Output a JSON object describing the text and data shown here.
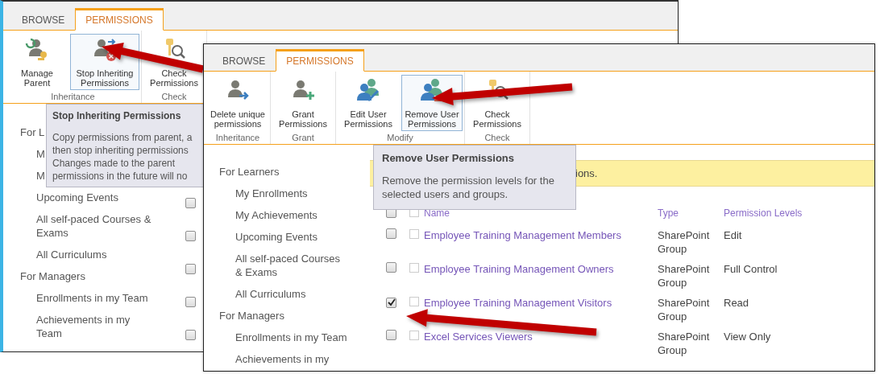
{
  "back_window": {
    "tabs": [
      {
        "label": "BROWSE",
        "selected": false
      },
      {
        "label": "PERMISSIONS",
        "selected": true
      }
    ],
    "ribbon_groups": [
      {
        "label": "Inheritance",
        "buttons": [
          {
            "label": "Manage Parent",
            "kind": "manage",
            "highlighted": false
          },
          {
            "label": "Stop Inheriting Permissions",
            "kind": "stop",
            "highlighted": true
          }
        ]
      },
      {
        "label": "Check",
        "buttons": [
          {
            "label": "Check Permissions",
            "kind": "check",
            "highlighted": false
          }
        ]
      }
    ],
    "tooltip": {
      "title": "Stop Inheriting Permissions",
      "body": "Copy permissions from parent, a\nthen stop inheriting permissions\nChanges made to the parent\npermissions in the future will no"
    },
    "sidebar": [
      {
        "label": "For L",
        "children": [
          {
            "label": "M"
          },
          {
            "label": "M"
          },
          {
            "label": "Upcoming Events"
          },
          {
            "label": "All self-paced Courses & Exams"
          },
          {
            "label": "All Curriculums"
          }
        ]
      },
      {
        "label": "For Managers",
        "children": [
          {
            "label": "Enrollments in my Team"
          },
          {
            "label": "Achievements in my Team"
          }
        ]
      }
    ],
    "row_checkboxes": [
      {
        "checked": false
      },
      {
        "checked": false
      },
      {
        "checked": false
      },
      {
        "checked": false
      },
      {
        "checked": false
      }
    ]
  },
  "front_window": {
    "tabs": [
      {
        "label": "BROWSE",
        "selected": false
      },
      {
        "label": "PERMISSIONS",
        "selected": true
      }
    ],
    "ribbon_groups": [
      {
        "label": "Inheritance",
        "buttons": [
          {
            "label": "Delete unique permissions",
            "kind": "delete",
            "highlighted": false
          }
        ]
      },
      {
        "label": "Grant",
        "buttons": [
          {
            "label": "Grant Permissions",
            "kind": "grant",
            "highlighted": false
          }
        ]
      },
      {
        "label": "Modify",
        "buttons": [
          {
            "label": "Edit User Permissions",
            "kind": "edit",
            "highlighted": false
          },
          {
            "label": "Remove User Permissions",
            "kind": "remove",
            "highlighted": true
          }
        ]
      },
      {
        "label": "Check",
        "buttons": [
          {
            "label": "Check Permissions",
            "kind": "check",
            "highlighted": false
          }
        ]
      }
    ],
    "tooltip": {
      "title": "Remove User Permissions",
      "body": "Remove the permission levels for the\nselected users and groups."
    },
    "banner": "ions.",
    "sidebar": [
      {
        "label": "For Learners",
        "children": [
          {
            "label": "My Enrollments"
          },
          {
            "label": "My Achievements"
          },
          {
            "label": "Upcoming Events"
          },
          {
            "label": "All self-paced Courses & Exams"
          },
          {
            "label": "All Curriculums"
          }
        ]
      },
      {
        "label": "For Managers",
        "children": [
          {
            "label": "Enrollments in my Team"
          },
          {
            "label": "Achievements in my"
          }
        ]
      }
    ],
    "table": {
      "header_checked": false,
      "header_selected": false,
      "columns": [
        "Name",
        "Type",
        "Permission Levels"
      ],
      "rows": [
        {
          "checked": false,
          "selected": false,
          "name": "Employee Training Management Members",
          "type": "SharePoint Group",
          "level": "Edit"
        },
        {
          "checked": false,
          "selected": false,
          "name": "Employee Training Management Owners",
          "type": "SharePoint Group",
          "level": "Full Control"
        },
        {
          "checked": true,
          "selected": false,
          "name": "Employee Training Management Visitors",
          "type": "SharePoint Group",
          "level": "Read"
        },
        {
          "checked": false,
          "selected": false,
          "name": "Excel Services Viewers",
          "type": "SharePoint Group",
          "level": "View Only"
        }
      ]
    }
  }
}
